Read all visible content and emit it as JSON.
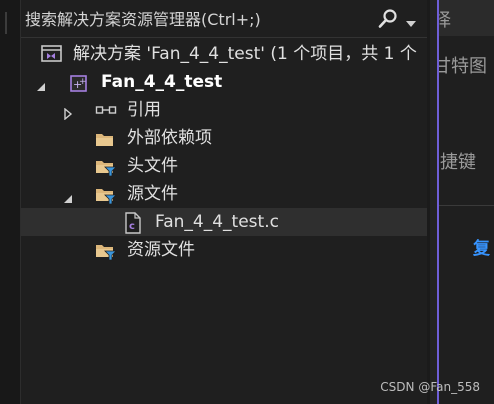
{
  "search": {
    "placeholder": "搜索解决方案资源管理器(Ctrl+;)"
  },
  "tree": {
    "solution": "解决方案 'Fan_4_4_test' (1 个项目，共 1 个",
    "project": "Fan_4_4_test",
    "references": "引用",
    "external_deps": "外部依赖项",
    "header_files": "头文件",
    "source_files": "源文件",
    "source_file": "Fan_4_4_test.c",
    "resource_files": "资源文件"
  },
  "right_panel": {
    "clip_top": "择",
    "clip_2": "甘特图",
    "clip_3": "捷键",
    "clip_link": "复"
  },
  "watermark": "CSDN @Fan_558",
  "colors": {
    "accent": "#6f5fd8",
    "folder": "#dcb67a",
    "filter": "#3a96dd",
    "link": "#3794ff"
  }
}
